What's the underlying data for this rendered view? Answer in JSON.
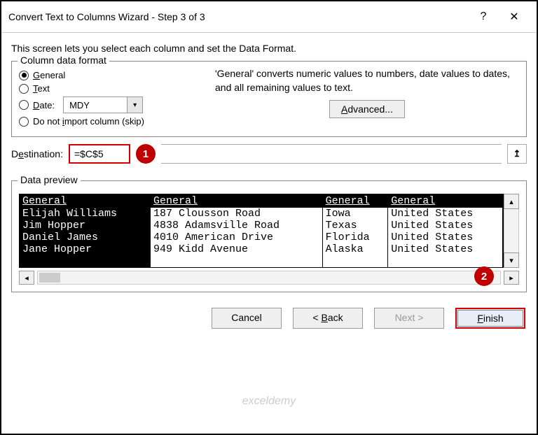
{
  "title": "Convert Text to Columns Wizard - Step 3 of 3",
  "description": "This screen lets you select each column and set the Data Format.",
  "columnFormat": {
    "legend": "Column data format",
    "general": "General",
    "text": "Text",
    "date": "Date:",
    "dateValue": "MDY",
    "skip": "Do not import column (skip)"
  },
  "note": "'General' converts numeric values to numbers, date values to dates, and all remaining values to text.",
  "advanced": "Advanced...",
  "destination": {
    "label": "Destination:",
    "value": "=$C$5"
  },
  "preview": {
    "legend": "Data preview",
    "headers": [
      "General",
      "General",
      "General",
      "General"
    ],
    "rows": [
      [
        "Elijah Williams",
        "187 Clousson Road",
        "Iowa",
        "United States"
      ],
      [
        "Jim Hopper",
        " 4838 Adamsville Road",
        "Texas",
        " United States"
      ],
      [
        "Daniel James",
        "4010 American Drive",
        "Florida",
        "United States"
      ],
      [
        "Jane Hopper",
        "949 Kidd Avenue",
        "Alaska",
        "United States"
      ]
    ]
  },
  "buttons": {
    "cancel": "Cancel",
    "back": "< Back",
    "next": "Next >",
    "finish": "Finish"
  },
  "callouts": {
    "one": "1",
    "two": "2"
  },
  "watermark": "exceldemy"
}
